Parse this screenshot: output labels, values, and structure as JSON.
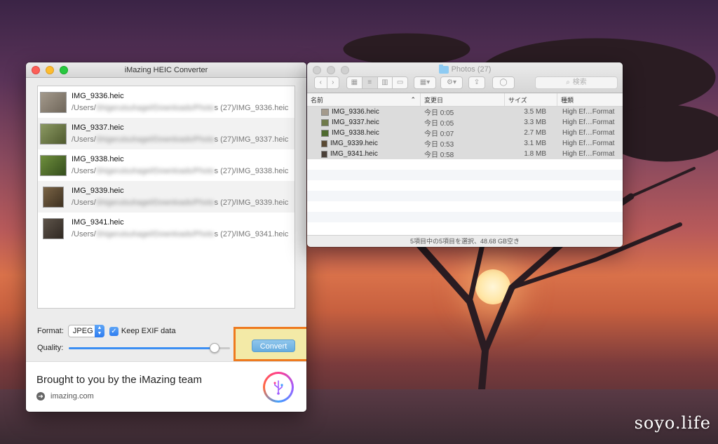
{
  "desktop": {
    "watermark": "soyo.life"
  },
  "imazing": {
    "title": "iMazing HEIC Converter",
    "files": [
      {
        "name": "IMG_9336.heic",
        "path_start": "/Users/",
        "path_hidden": "Shigerutsuhagel/Downloads/Photo",
        "path_end": "s (27)/IMG_9336.heic",
        "thumb_color": "#8c8378"
      },
      {
        "name": "IMG_9337.heic",
        "path_start": "/Users/",
        "path_hidden": "Shigerutsuhagel/Downloads/Photo",
        "path_end": "s (27)/IMG_9337.heic",
        "thumb_color": "#6f7a4a"
      },
      {
        "name": "IMG_9338.heic",
        "path_start": "/Users/",
        "path_hidden": "Shigerutsuhagel/Downloads/Photo",
        "path_end": "s (27)/IMG_9338.heic",
        "thumb_color": "#4e6a2f"
      },
      {
        "name": "IMG_9339.heic",
        "path_start": "/Users/",
        "path_hidden": "Shigerutsuhagel/Downloads/Photo",
        "path_end": "s (27)/IMG_9339.heic",
        "thumb_color": "#5a4a33"
      },
      {
        "name": "IMG_9341.heic",
        "path_start": "/Users/",
        "path_hidden": "Shigerutsuhagel/Downloads/Photo",
        "path_end": "s (27)/IMG_9341.heic",
        "thumb_color": "#4a4038"
      }
    ],
    "format_label": "Format:",
    "format_value": "JPEG",
    "keep_exif_label": "Keep EXIF data",
    "keep_exif_checked": true,
    "quality_label": "Quality:",
    "quality_value": "95",
    "quality_fraction": 0.93,
    "convert_label": "Convert",
    "promo_title": "Brought to you by the iMazing team",
    "promo_link": "imazing.com"
  },
  "finder": {
    "title": "Photos (27)",
    "search_placeholder": "検索",
    "columns": {
      "name": "名前",
      "date": "変更日",
      "size": "サイズ",
      "kind": "種類"
    },
    "files": [
      {
        "name": "IMG_9336.heic",
        "date": "今日 0:05",
        "size": "3.5 MB",
        "kind": "High Ef…Format"
      },
      {
        "name": "IMG_9337.heic",
        "date": "今日 0:05",
        "size": "3.3 MB",
        "kind": "High Ef…Format"
      },
      {
        "name": "IMG_9338.heic",
        "date": "今日 0:07",
        "size": "2.7 MB",
        "kind": "High Ef…Format"
      },
      {
        "name": "IMG_9339.heic",
        "date": "今日 0:53",
        "size": "3.1 MB",
        "kind": "High Ef…Format"
      },
      {
        "name": "IMG_9341.heic",
        "date": "今日 0:58",
        "size": "1.8 MB",
        "kind": "High Ef…Format"
      }
    ],
    "status": "5項目中の5項目を選択、48.68 GB空き"
  }
}
